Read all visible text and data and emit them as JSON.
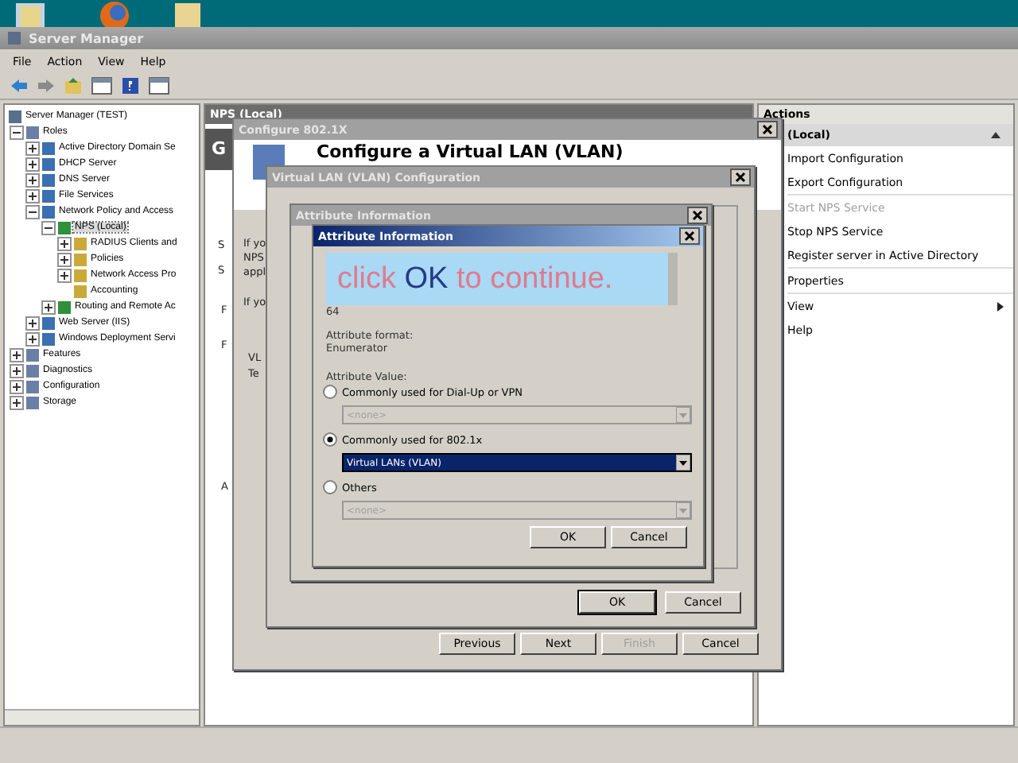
{
  "window": {
    "title": "Server Manager"
  },
  "menu": [
    "File",
    "Action",
    "View",
    "Help"
  ],
  "tree": [
    {
      "label": "Server Manager (TEST)",
      "children": [
        {
          "label": "Roles",
          "expanded": true,
          "selected": false,
          "children": [
            {
              "label": "Active Directory Domain Se",
              "expanded": false,
              "selected": false
            },
            {
              "label": "DHCP Server",
              "expanded": false,
              "selected": false
            },
            {
              "label": "DNS Server",
              "expanded": false,
              "selected": false
            },
            {
              "label": "File Services",
              "expanded": false,
              "selected": false
            },
            {
              "label": "Network Policy and Access",
              "expanded": true,
              "selected": false,
              "children": [
                {
                  "label": "NPS (Local)",
                  "expanded": true,
                  "selected": true,
                  "children": [
                    {
                      "label": "RADIUS Clients and",
                      "expanded": false,
                      "selected": false
                    },
                    {
                      "label": "Policies",
                      "expanded": false,
                      "selected": false
                    },
                    {
                      "label": "Network Access Pro",
                      "expanded": false,
                      "selected": false
                    },
                    {
                      "label": "Accounting",
                      "selected": false
                    }
                  ]
                },
                {
                  "label": "Routing and Remote Ac",
                  "expanded": false,
                  "selected": false
                }
              ]
            },
            {
              "label": "Web Server (IIS)",
              "expanded": false,
              "selected": false
            },
            {
              "label": "Windows Deployment Servi",
              "expanded": false,
              "selected": false
            }
          ]
        },
        {
          "label": "Features",
          "expanded": false,
          "selected": false
        },
        {
          "label": "Diagnostics",
          "expanded": false,
          "selected": false
        },
        {
          "label": "Configuration",
          "expanded": false,
          "selected": false
        },
        {
          "label": "Storage",
          "expanded": false,
          "selected": false
        }
      ]
    }
  ],
  "center_pane": {
    "header": "NPS (Local)",
    "fragments": [
      "G",
      "S",
      "S",
      "F",
      "F",
      "A"
    ]
  },
  "actions": {
    "header": "Actions",
    "section": "(Local)",
    "items": [
      {
        "label": "Import Configuration",
        "disabled": false,
        "submenu": false,
        "separator_after": false
      },
      {
        "label": "Export Configuration",
        "disabled": false,
        "submenu": false,
        "separator_after": true
      },
      {
        "label": "Start NPS Service",
        "disabled": true,
        "submenu": false,
        "separator_after": false
      },
      {
        "label": "Stop NPS Service",
        "disabled": false,
        "submenu": false,
        "separator_after": false
      },
      {
        "label": "Register server in Active Directory",
        "disabled": false,
        "submenu": false,
        "separator_after": true
      },
      {
        "label": "Properties",
        "disabled": false,
        "submenu": false,
        "separator_after": true
      },
      {
        "label": "View",
        "disabled": false,
        "submenu": true,
        "separator_after": false
      },
      {
        "label": "Help",
        "disabled": false,
        "submenu": false,
        "separator_after": false
      }
    ]
  },
  "wizard": {
    "title": "Configure 802.1X",
    "heading": "Configure a Virtual LAN (VLAN)",
    "fragments": [
      "If yo",
      "NPS",
      "appl",
      "If yo",
      "VL",
      "Te"
    ],
    "buttons": [
      {
        "label": "Previous",
        "disabled": false
      },
      {
        "label": "Next",
        "disabled": false
      },
      {
        "label": "Finish",
        "disabled": true
      },
      {
        "label": "Cancel",
        "disabled": false
      }
    ]
  },
  "vlan_dialog": {
    "title": "Virtual LAN (VLAN) Configuration",
    "buttons": [
      {
        "label": "OK",
        "default": true
      },
      {
        "label": "Cancel",
        "default": false
      }
    ]
  },
  "back_dialog": {
    "title": "Attribute Information"
  },
  "attribute_dialog": {
    "title": "Attribute Information",
    "caption_parts": [
      {
        "text": "click",
        "emphasis": false
      },
      {
        "text": "OK",
        "emphasis": true
      },
      {
        "text": "to continue.",
        "emphasis": false
      }
    ],
    "value": "64",
    "format_label": "Attribute format:",
    "format": "Enumerator",
    "value_label": "Attribute Value:",
    "options": [
      {
        "label": "Commonly used for Dial-Up or VPN",
        "selected": false,
        "dropdown": "<none>"
      },
      {
        "label": "Commonly used for 802.1x",
        "selected": true,
        "dropdown": "Virtual LANs (VLAN)"
      },
      {
        "label": "Others",
        "selected": false,
        "dropdown": "<none>"
      }
    ],
    "buttons": [
      {
        "label": "OK"
      },
      {
        "label": "Cancel"
      }
    ]
  }
}
